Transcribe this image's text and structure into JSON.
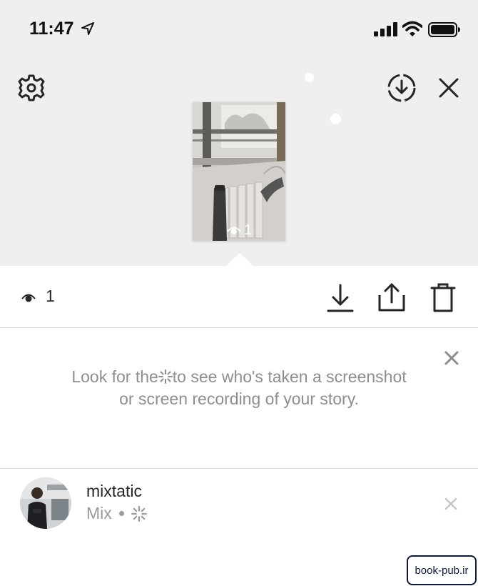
{
  "status_bar": {
    "time": "11:47"
  },
  "story": {
    "views": "1"
  },
  "views_row": {
    "count": "1"
  },
  "tip": {
    "text_before": "Look for the",
    "text_after": "to see who's taken a screenshot or screen recording of your story."
  },
  "viewers": [
    {
      "username": "mixtatic",
      "name": "Mix"
    }
  ],
  "icons": {
    "settings": "gear-icon",
    "save": "download-circle-icon",
    "close": "close-icon",
    "views": "eye-icon",
    "download": "download-icon",
    "share": "share-icon",
    "delete": "trash-icon",
    "screenshot_indicator": "sparkle-icon"
  },
  "watermark": "book-pub.ir",
  "colors": {
    "top_background": "#efefef",
    "secondary_text": "#8e8e8e",
    "divider": "#dbdbdb"
  }
}
